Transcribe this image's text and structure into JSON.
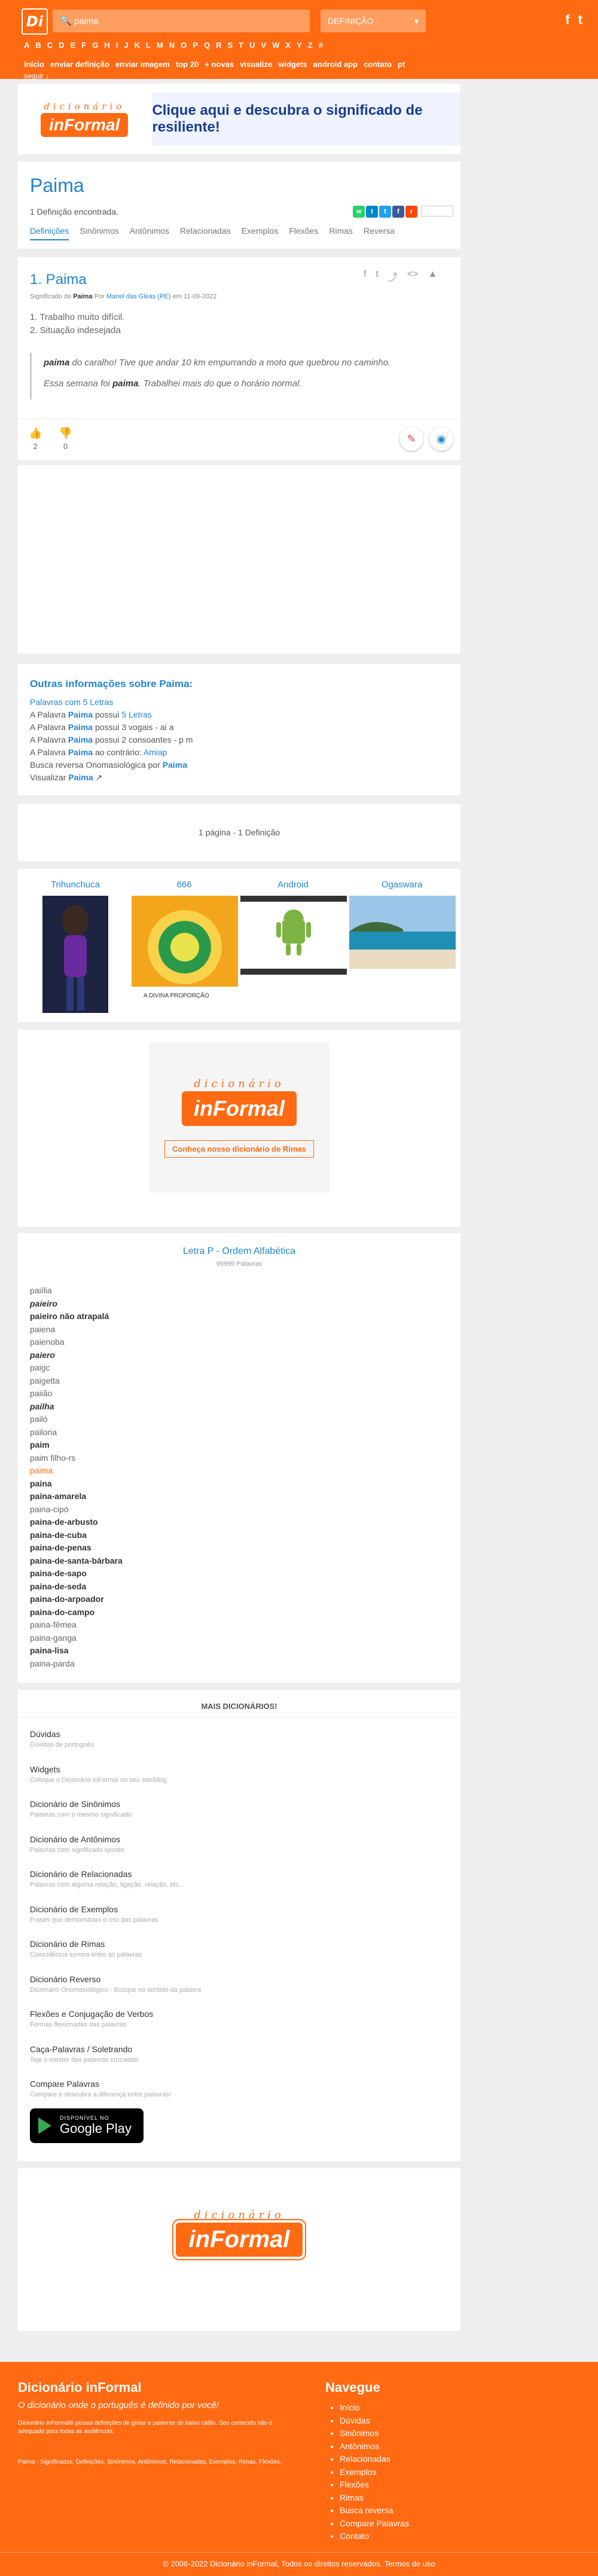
{
  "header": {
    "logo": "Di",
    "search_value": "paima",
    "search_placeholder": "Buscar",
    "select_value": "DEFINIÇÃO",
    "letters": [
      "A",
      "B",
      "C",
      "D",
      "E",
      "F",
      "G",
      "H",
      "I",
      "J",
      "K",
      "L",
      "M",
      "N",
      "O",
      "P",
      "Q",
      "R",
      "S",
      "T",
      "U",
      "V",
      "W",
      "X",
      "Y",
      "Z",
      "#"
    ],
    "nav": [
      "início",
      "enviar definição",
      "enviar imagem",
      "top 20",
      "+ novas",
      "visualize",
      "widgets",
      "android app",
      "contato",
      "pt"
    ],
    "nav2": "seguir ↓",
    "social": [
      "f",
      "t"
    ]
  },
  "banner": {
    "dic": "dicionário",
    "informal": "inFormal",
    "text": "Clique aqui e descubra o significado de resiliente!"
  },
  "word": {
    "title": "Paima",
    "count": "1 Definição encontrada.",
    "tabs": [
      "Definições",
      "Sinônimos",
      "Antônimos",
      "Relacionadas",
      "Exemplos",
      "Flexões",
      "Rimas",
      "Reversa"
    ]
  },
  "definition": {
    "title": "1. Paima",
    "meta_prefix": "Significado de",
    "meta_word": "Paima",
    "meta_by": "Por",
    "meta_author": "Mariel das Gleas (PE)",
    "meta_date": "em 11-09-2022",
    "items": [
      "1. Trabalho muito difícil.",
      "2. Situação indesejada"
    ],
    "example1_bold": "paima",
    "example1_rest": " do caralho! Tive que andar 10 km empurrando a moto que quebrou no caminho.",
    "example2_pre": "Essa semana foi ",
    "example2_bold": "paima",
    "example2_rest": ". Trabalhei mais do que o horário normal.",
    "upvotes": "2",
    "downvotes": "0"
  },
  "info": {
    "title_pre": "Outras informações sobre ",
    "title_word": "Paima",
    "lines": [
      {
        "pre": "",
        "link": "Palavras com 5 Letras",
        "post": ""
      },
      {
        "pre": "A Palavra ",
        "link": "Paima",
        "post": " possui ",
        "link2": "5 Letras"
      },
      {
        "pre": "A Palavra ",
        "link": "Paima",
        "post": " possui 3 vogais - ai a"
      },
      {
        "pre": "A Palavra ",
        "link": "Paima",
        "post": " possui 2 consoantes - p m"
      },
      {
        "pre": "A Palavra ",
        "link": "Paima",
        "post": " ao contrário: ",
        "link2": "Amiap"
      },
      {
        "pre": "Busca reversa Onomasiológica por ",
        "link": "Paima",
        "post": ""
      },
      {
        "pre": "Visualizar ",
        "link": "Paima",
        "post": " ↗"
      }
    ]
  },
  "pager": "1 página - 1 Definição",
  "related": [
    "Trihunchuca",
    "666",
    "Android",
    "Ogaswara"
  ],
  "ad2": {
    "link": "Conheça nosso dicionário de Rimas"
  },
  "alpha": {
    "title": "Letra P - Ordem Alfabética",
    "subtitle": "99999 Palavras",
    "words": [
      {
        "t": "paiília",
        "s": ""
      },
      {
        "t": "paieiro",
        "s": "i"
      },
      {
        "t": "paieiro não atrapalá",
        "s": "b"
      },
      {
        "t": "paiena",
        "s": ""
      },
      {
        "t": "paienoba",
        "s": ""
      },
      {
        "t": "paiero",
        "s": "i"
      },
      {
        "t": "paigc",
        "s": ""
      },
      {
        "t": "paigetta",
        "s": ""
      },
      {
        "t": "paiião",
        "s": ""
      },
      {
        "t": "pailha",
        "s": "i"
      },
      {
        "t": "pailó",
        "s": ""
      },
      {
        "t": "pailona",
        "s": ""
      },
      {
        "t": "paim",
        "s": "b"
      },
      {
        "t": "paim filho-rs",
        "s": ""
      },
      {
        "t": "paima",
        "s": "cur"
      },
      {
        "t": "paina",
        "s": "b"
      },
      {
        "t": "paina-amarela",
        "s": "b"
      },
      {
        "t": "paina-cipó",
        "s": ""
      },
      {
        "t": "paina-de-arbusto",
        "s": "b"
      },
      {
        "t": "paina-de-cuba",
        "s": "b"
      },
      {
        "t": "paina-de-penas",
        "s": "b"
      },
      {
        "t": "paina-de-santa-bárbara",
        "s": "b"
      },
      {
        "t": "paina-de-sapo",
        "s": "b"
      },
      {
        "t": "paina-de-seda",
        "s": "b"
      },
      {
        "t": "paina-do-arpoador",
        "s": "b"
      },
      {
        "t": "paina-do-campo",
        "s": "b"
      },
      {
        "t": "paina-fêmea",
        "s": ""
      },
      {
        "t": "paina-ganga",
        "s": ""
      },
      {
        "t": "paina-lisa",
        "s": "b"
      },
      {
        "t": "paina-parda",
        "s": ""
      }
    ]
  },
  "more": {
    "title": "MAIS DICIONÁRIOS!",
    "items": [
      {
        "t": "Dúvidas",
        "s": "Dúvidas de português"
      },
      {
        "t": "Widgets",
        "s": "Coloque o Dicionário inFormal no seu site/blog"
      },
      {
        "t": "Dicionário de Sinônimos",
        "s": "Palavras com o mesmo significado"
      },
      {
        "t": "Dicionário de Antônimos",
        "s": "Palavras com significado oposto"
      },
      {
        "t": "Dicionário de Relacionadas",
        "s": "Palavras com alguma relação, ligação, relação, etc..."
      },
      {
        "t": "Dicionário de Exemplos",
        "s": "Frases que demonstram o uso das palavras"
      },
      {
        "t": "Dicionário de Rimas",
        "s": "Coincidência sonora entre as palavras"
      },
      {
        "t": "Dicionário Reverso",
        "s": "Dicionário Onomasiológico - Busque no sentido da palavra"
      },
      {
        "t": "Flexões e Conjugação de Verbos",
        "s": "Formas flexionadas das palavras"
      },
      {
        "t": "Caça-Palavras / Soletrando",
        "s": "Teje o mestre das palavras cruzadas!"
      },
      {
        "t": "Compare Palavras",
        "s": "Compare e descubra a diferença entre palavras!"
      }
    ],
    "gplay_a": "DISPONÍVEL NO",
    "gplay_b": "Google Play"
  },
  "footer": {
    "title": "Dicionário inFormal",
    "slogan": "O dicionário onde o português é definido por você!",
    "desc": "Dicionário inFormal® possui definições de gírias e palavras de baixo calão. Seu conteúdo não é adequado para todas as audiências.",
    "tags": "Paima - Significados, Definições, Sinônimos, Antônimos, Relacionadas, Exemplos, Rimas, Flexões.",
    "nav_title": "Navegue",
    "nav": [
      "Início",
      "Dúvidas",
      "Sinônimos",
      "Antônimos",
      "Relacionadas",
      "Exemplos",
      "Flexões",
      "Rimas",
      "Busca reversa",
      "Compare Palavras",
      "Contato"
    ],
    "copyright": "© 2006-2022 Dicionário inFormal, Todos os direitos reservados.",
    "terms": "Termos de uso"
  },
  "colors": {
    "brand": "#ff6a13",
    "link": "#2185d0"
  }
}
